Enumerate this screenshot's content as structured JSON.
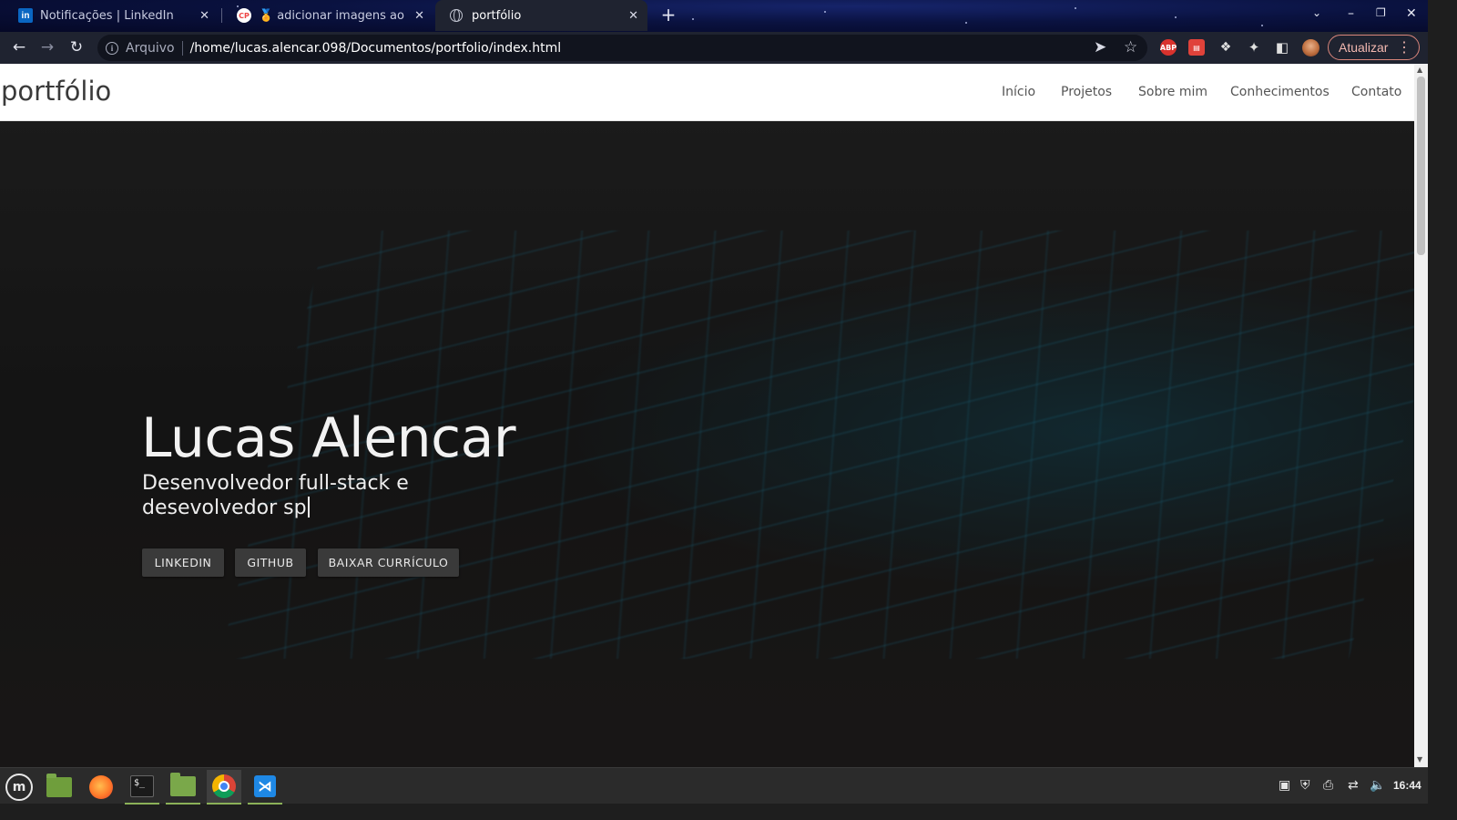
{
  "browser": {
    "tabs": [
      {
        "title": "Notificações | LinkedIn",
        "favicon": "linkedin-icon"
      },
      {
        "title": "adicionar imagens ao proj",
        "favicon": "codepen-icon"
      },
      {
        "title": "portfólio",
        "favicon": "globe-icon",
        "active": true
      }
    ],
    "omnibox": {
      "security_label": "Arquivo",
      "url": "/home/lucas.alencar.098/Documentos/portfolio/index.html"
    },
    "update_button": "Atualizar",
    "extensions": {
      "abp_label": "ABP"
    }
  },
  "site": {
    "brand": "portfólio",
    "nav": [
      "Início",
      "Projetos",
      "Sobre mim",
      "Conhecimentos",
      "Contato"
    ],
    "hero": {
      "name": "Lucas Alencar",
      "subtitle": "Desenvolvedor full-stack e desevolvedor sp",
      "buttons": [
        "LINKEDIN",
        "GITHUB",
        "BAIXAR CURRÍCULO"
      ]
    }
  },
  "taskbar": {
    "clock": "16:44",
    "apps": [
      "menu-icon",
      "folder-icon",
      "firefox-icon",
      "terminal-icon",
      "files-icon",
      "chrome-icon",
      "vscode-icon"
    ]
  }
}
